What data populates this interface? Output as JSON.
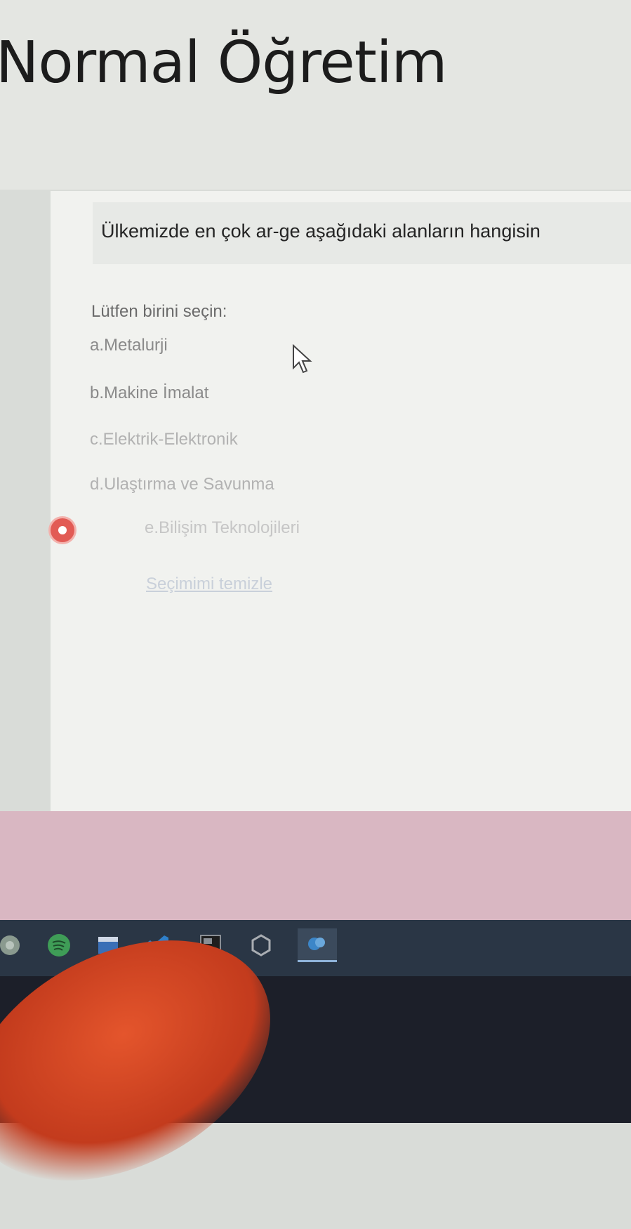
{
  "header": {
    "title": "Normal Öğretim"
  },
  "question": {
    "text": "Ülkemizde en çok ar-ge aşağıdaki alanların hangisin",
    "prompt": "Lütfen birini seçin:",
    "options": [
      {
        "label": "a.Metalurji",
        "selected": false
      },
      {
        "label": "b.Makine İmalat",
        "selected": false
      },
      {
        "label": "c.Elektrik-Elektronik",
        "selected": false
      },
      {
        "label": "d.Ulaştırma ve Savunma",
        "selected": false
      },
      {
        "label": "e.Bilişim Teknolojileri",
        "selected": true
      }
    ],
    "clear_label": "Seçimimi temizle"
  },
  "colors": {
    "radio_selected": "#e25b55",
    "taskbar": "#2a3645",
    "footer_band": "#d9b7c2"
  },
  "taskbar": {
    "icons": [
      "chrome-icon",
      "spotify-icon",
      "files-icon",
      "vscode-icon",
      "pycharm-icon",
      "unity-icon",
      "active-app-icon"
    ]
  }
}
